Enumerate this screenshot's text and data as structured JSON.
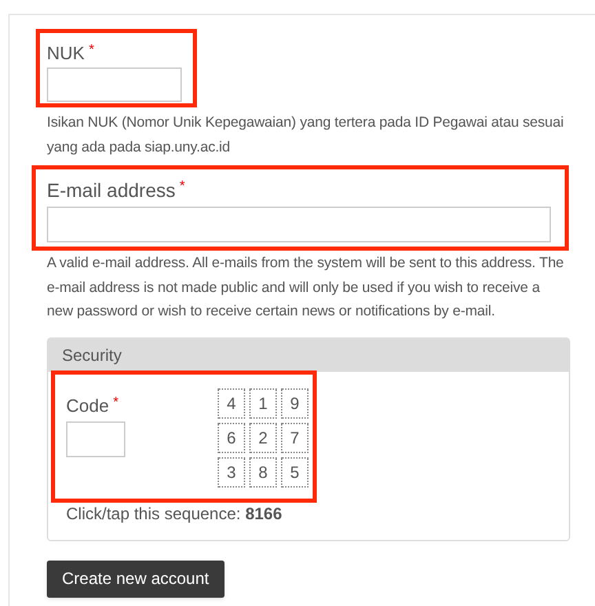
{
  "fields": [
    {
      "label": "NUK",
      "required": "*",
      "highlighted": true,
      "description": "Isikan NUK (Nomor Unik Kepegawaian) yang tertera pada ID Pegawai atau sesuai yang ada pada siap.uny.ac.id"
    },
    {
      "label": "E-mail address",
      "required": "*",
      "highlighted": true,
      "description": "A valid e-mail address. All e-mails from the system will be sent to this address. The e-mail address is not made public and will only be used if you wish to receive a new password or wish to receive certain news or notifications by e-mail."
    }
  ],
  "security": {
    "title": "Security",
    "code_label": "Code",
    "required": "*",
    "highlighted": true,
    "keypad": [
      "4",
      "1",
      "9",
      "6",
      "2",
      "7",
      "3",
      "8",
      "5"
    ],
    "instruction": "Click/tap this sequence: **8166**"
  },
  "submit": "Create new account"
}
